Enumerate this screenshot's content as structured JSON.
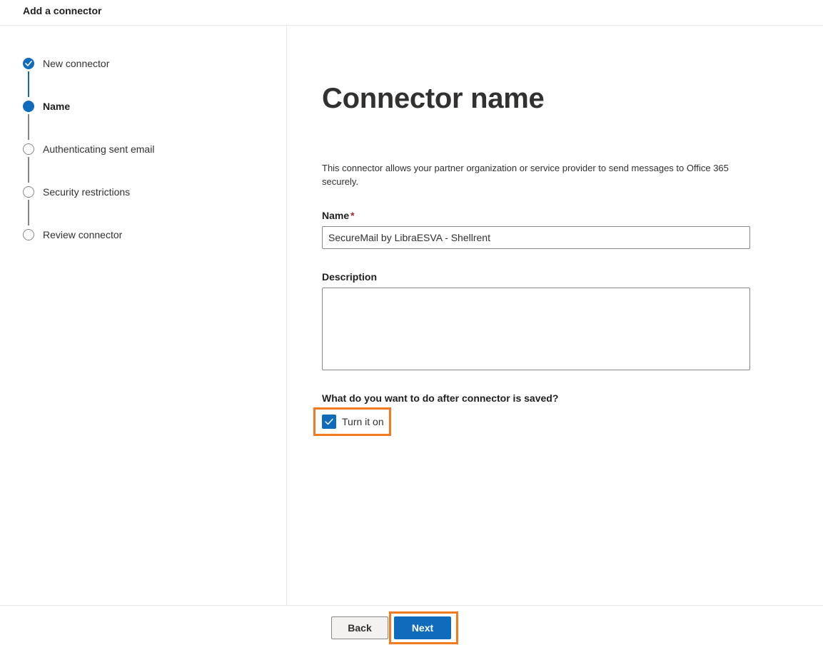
{
  "header": {
    "title": "Add a connector"
  },
  "steps": [
    {
      "label": "New connector",
      "state": "done",
      "icon": "checkmark-icon"
    },
    {
      "label": "Name",
      "state": "current",
      "icon": "current-step-icon"
    },
    {
      "label": "Authenticating sent email",
      "state": "todo",
      "icon": "empty-circle-icon"
    },
    {
      "label": "Security restrictions",
      "state": "todo",
      "icon": "empty-circle-icon"
    },
    {
      "label": "Review connector",
      "state": "todo",
      "icon": "empty-circle-icon"
    }
  ],
  "main": {
    "heading": "Connector name",
    "description": "This connector allows your partner organization or service provider to send messages to Office 365 securely.",
    "name_field": {
      "label": "Name",
      "required_marker": "*",
      "value": "SecureMail by LibraESVA - Shellrent"
    },
    "description_field": {
      "label": "Description",
      "value": ""
    },
    "after_save": {
      "question": "What do you want to do after connector is saved?",
      "checkbox_label": "Turn it on",
      "checked": true
    }
  },
  "footer": {
    "back_label": "Back",
    "next_label": "Next"
  },
  "colors": {
    "accent": "#0f6cbd",
    "highlight": "#f47a20",
    "required": "#a4262c"
  }
}
